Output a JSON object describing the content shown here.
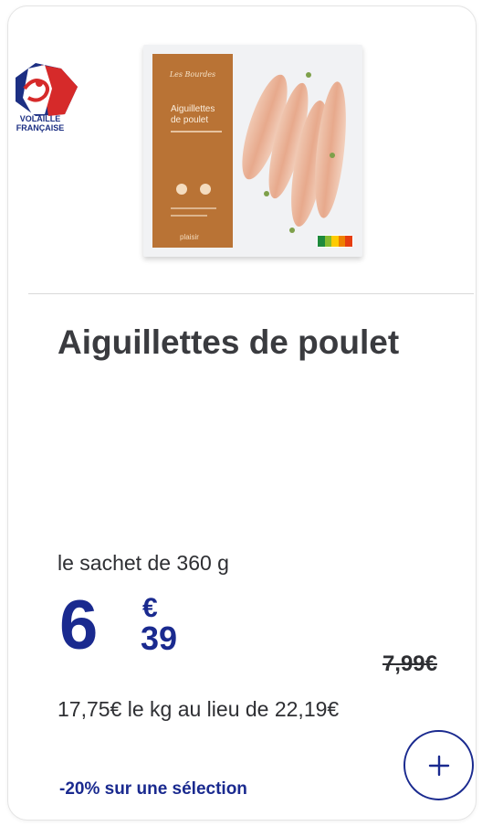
{
  "badge": {
    "line1": "VOLAILLE",
    "line2": "FRANÇAISE"
  },
  "product": {
    "image_brand": "Les Bourdes",
    "image_name_line1": "Aiguillettes",
    "image_name_line2": "de poulet",
    "image_logo": "plaisir",
    "title": "Aiguillettes de poulet",
    "size_label": "le sachet de 360 g"
  },
  "price": {
    "integer": "6",
    "currency": "€",
    "cents": "39",
    "old_price": "7,99€",
    "unit_price": "17,75€ le kg au lieu de 22,19€"
  },
  "promo": {
    "text": "-20% sur une sélection"
  },
  "icons": {
    "add": "plus-icon",
    "badge": "volaille-francaise-logo"
  },
  "colors": {
    "accent": "#1a2a8f",
    "text": "#2e2f33",
    "title": "#3a3b3f"
  }
}
